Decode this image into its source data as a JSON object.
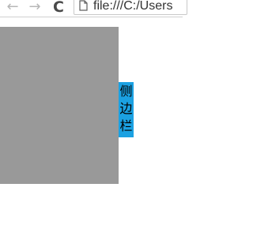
{
  "browser": {
    "back_icon": "←",
    "forward_icon": "→",
    "reload_icon": "C",
    "address": "file:///C:/Users"
  },
  "page": {
    "panel_color": "#999999",
    "sidebar": {
      "label": "侧边栏",
      "chars": [
        "侧",
        "边",
        "栏"
      ],
      "color": "#1ba1e2"
    }
  }
}
